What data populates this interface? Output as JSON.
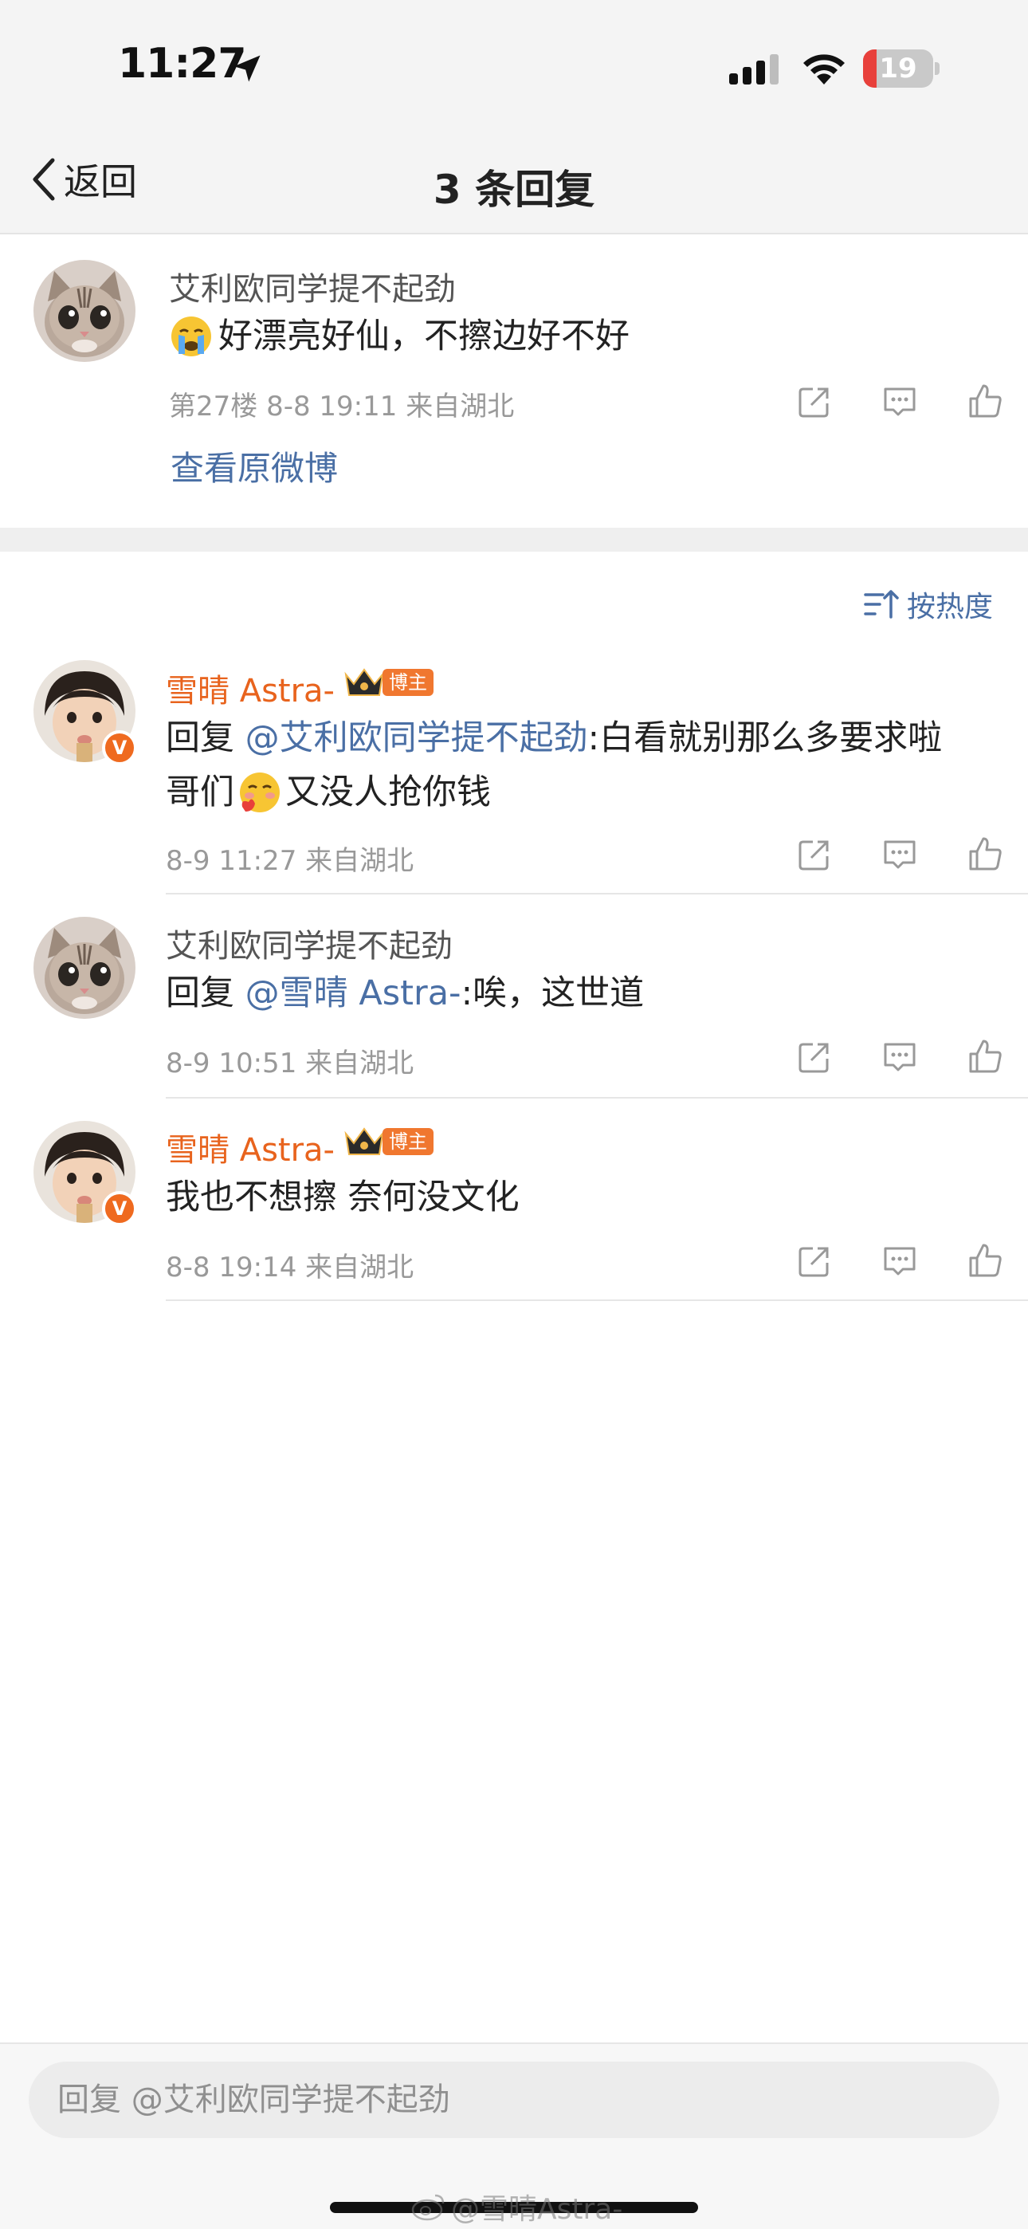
{
  "status_bar": {
    "time": "11:27",
    "battery": "19"
  },
  "nav": {
    "back_label": "返回",
    "title": "3 条回复"
  },
  "original_comment": {
    "username": "艾利欧同学提不起劲",
    "content": "好漂亮好仙，不擦边好不好",
    "meta": "第27楼  8-8 19:11  来自湖北",
    "view_original_label": "查看原微博"
  },
  "sort_label": "按热度",
  "replies": [
    {
      "username": "雪晴 Astra-",
      "badge": "博主",
      "reply_prefix": "回复 ",
      "mention": "@艾利欧同学提不起劲",
      "content_line1": ":白看就别那么多要求啦",
      "content_line2a": "哥们",
      "content_line2b": "又没人抢你钱",
      "meta": "8-9 11:27  来自湖北"
    },
    {
      "username": "艾利欧同学提不起劲",
      "reply_prefix": "回复 ",
      "mention": "@雪晴 Astra-",
      "content": ":唉，这世道",
      "meta": "8-9 10:51  来自湖北"
    },
    {
      "username": "雪晴 Astra-",
      "badge": "博主",
      "content": "我也不想擦 奈何没文化",
      "meta": "8-8 19:14  来自湖北"
    }
  ],
  "reply_input": {
    "placeholder": "回复 @艾利欧同学提不起劲"
  },
  "watermark": "@雪晴Astra-",
  "colors": {
    "accent_blue": "#4a6fa5",
    "vip_orange": "#e8631d",
    "badge_orange": "#f0772f",
    "battery_red": "#e8403b"
  },
  "icons": [
    "location-arrow-icon",
    "signal-icon",
    "wifi-icon",
    "battery-icon",
    "back-chevron-icon",
    "share-icon",
    "comment-icon",
    "like-icon",
    "sort-icon",
    "crown-icon",
    "crying-emoji-icon",
    "shy-emoji-icon",
    "weibo-logo-icon"
  ]
}
